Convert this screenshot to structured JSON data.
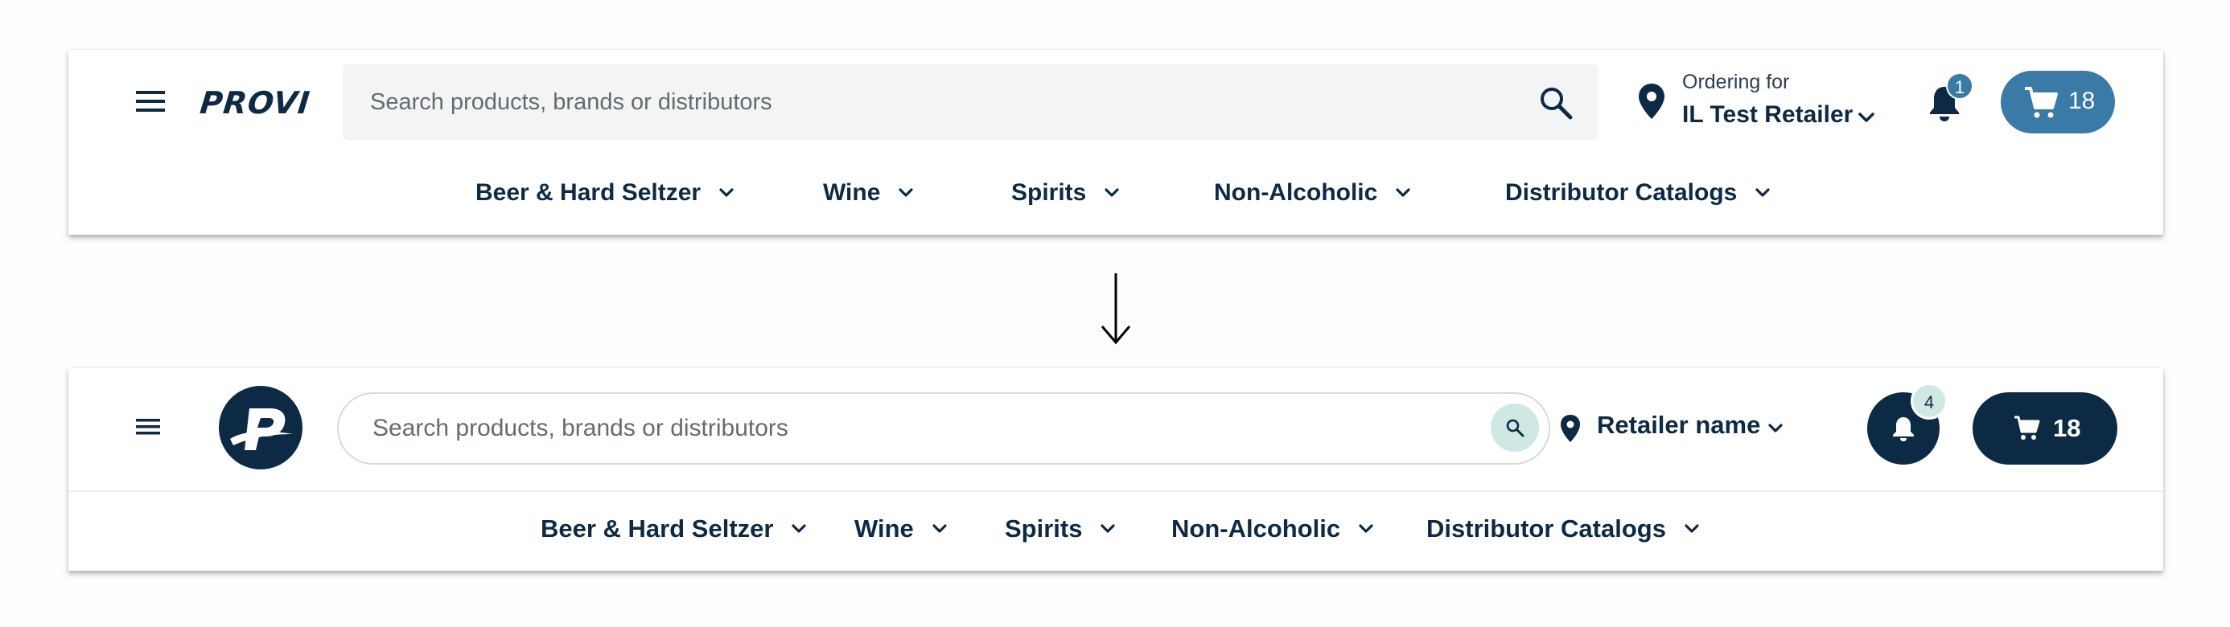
{
  "colors": {
    "old_accent": "#3a7aa6",
    "navy": "#0d2a45",
    "mint": "#cfe8e3",
    "search_bg": "#f3f4f4"
  },
  "old_header": {
    "menu_icon": "hamburger-menu-icon",
    "logo_text": "PROVI",
    "search": {
      "placeholder": "Search products, brands or distributors",
      "icon": "search-icon"
    },
    "location": {
      "icon": "map-pin-icon",
      "label": "Ordering for",
      "retailer": "IL Test Retailer"
    },
    "notifications": {
      "icon": "bell-icon",
      "count": "1"
    },
    "cart": {
      "icon": "cart-icon",
      "count": "18"
    },
    "nav": [
      {
        "label": "Beer & Hard Seltzer"
      },
      {
        "label": "Wine"
      },
      {
        "label": "Spirits"
      },
      {
        "label": "Non-Alcoholic"
      },
      {
        "label": "Distributor Catalogs"
      }
    ]
  },
  "transition_icon": "down-arrow-icon",
  "new_header": {
    "menu_icon": "hamburger-menu-icon",
    "logo_icon": "provi-p-logo-icon",
    "search": {
      "placeholder": "Search products, brands or distributors",
      "icon": "search-icon"
    },
    "location": {
      "icon": "map-pin-icon",
      "retailer": "Retailer name"
    },
    "notifications": {
      "icon": "bell-icon",
      "count": "4"
    },
    "cart": {
      "icon": "cart-icon",
      "count": "18"
    },
    "nav": [
      {
        "label": "Beer & Hard Seltzer"
      },
      {
        "label": "Wine"
      },
      {
        "label": "Spirits"
      },
      {
        "label": "Non-Alcoholic"
      },
      {
        "label": "Distributor Catalogs"
      }
    ]
  }
}
